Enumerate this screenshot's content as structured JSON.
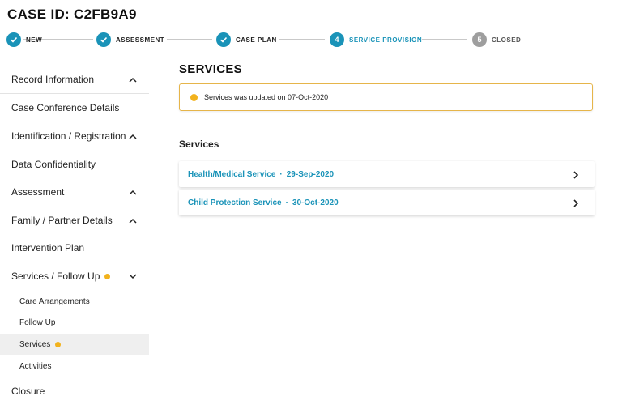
{
  "case": {
    "title": "CASE ID: C2FB9A9"
  },
  "stepper": {
    "steps": [
      {
        "label": "NEW",
        "number": "",
        "state": "done"
      },
      {
        "label": "ASSESSMENT",
        "number": "",
        "state": "done"
      },
      {
        "label": "CASE PLAN",
        "number": "",
        "state": "done"
      },
      {
        "label": "SERVICE PROVISION",
        "number": "4",
        "state": "active"
      },
      {
        "label": "CLOSED",
        "number": "5",
        "state": "pending"
      }
    ]
  },
  "sidebar": {
    "items": [
      {
        "label": "Record Information",
        "chevron": "up"
      },
      {
        "label": "Case Conference Details"
      },
      {
        "label": "Identification / Registration",
        "chevron": "up"
      },
      {
        "label": "Data Confidentiality"
      },
      {
        "label": "Assessment",
        "chevron": "up"
      },
      {
        "label": "Family / Partner Details",
        "chevron": "up"
      },
      {
        "label": "Intervention Plan"
      },
      {
        "label": "Services / Follow Up",
        "chevron": "down",
        "dot": true
      }
    ],
    "subitems": [
      {
        "label": "Care Arrangements"
      },
      {
        "label": "Follow Up"
      },
      {
        "label": "Services",
        "dot": true,
        "selected": true
      },
      {
        "label": "Activities"
      }
    ],
    "closure": {
      "label": "Closure"
    }
  },
  "main": {
    "title": "SERVICES",
    "alert": {
      "text": "Services was updated on 07-Oct-2020"
    },
    "services_heading": "Services",
    "services": [
      {
        "name": "Health/Medical Service",
        "separator": "·",
        "date": "29-Sep-2020"
      },
      {
        "name": "Child Protection Service",
        "separator": "·",
        "date": "30-Oct-2020"
      }
    ]
  },
  "colors": {
    "accent": "#1a93b8",
    "warning": "#f2b21c",
    "pending": "#9e9e9e"
  }
}
